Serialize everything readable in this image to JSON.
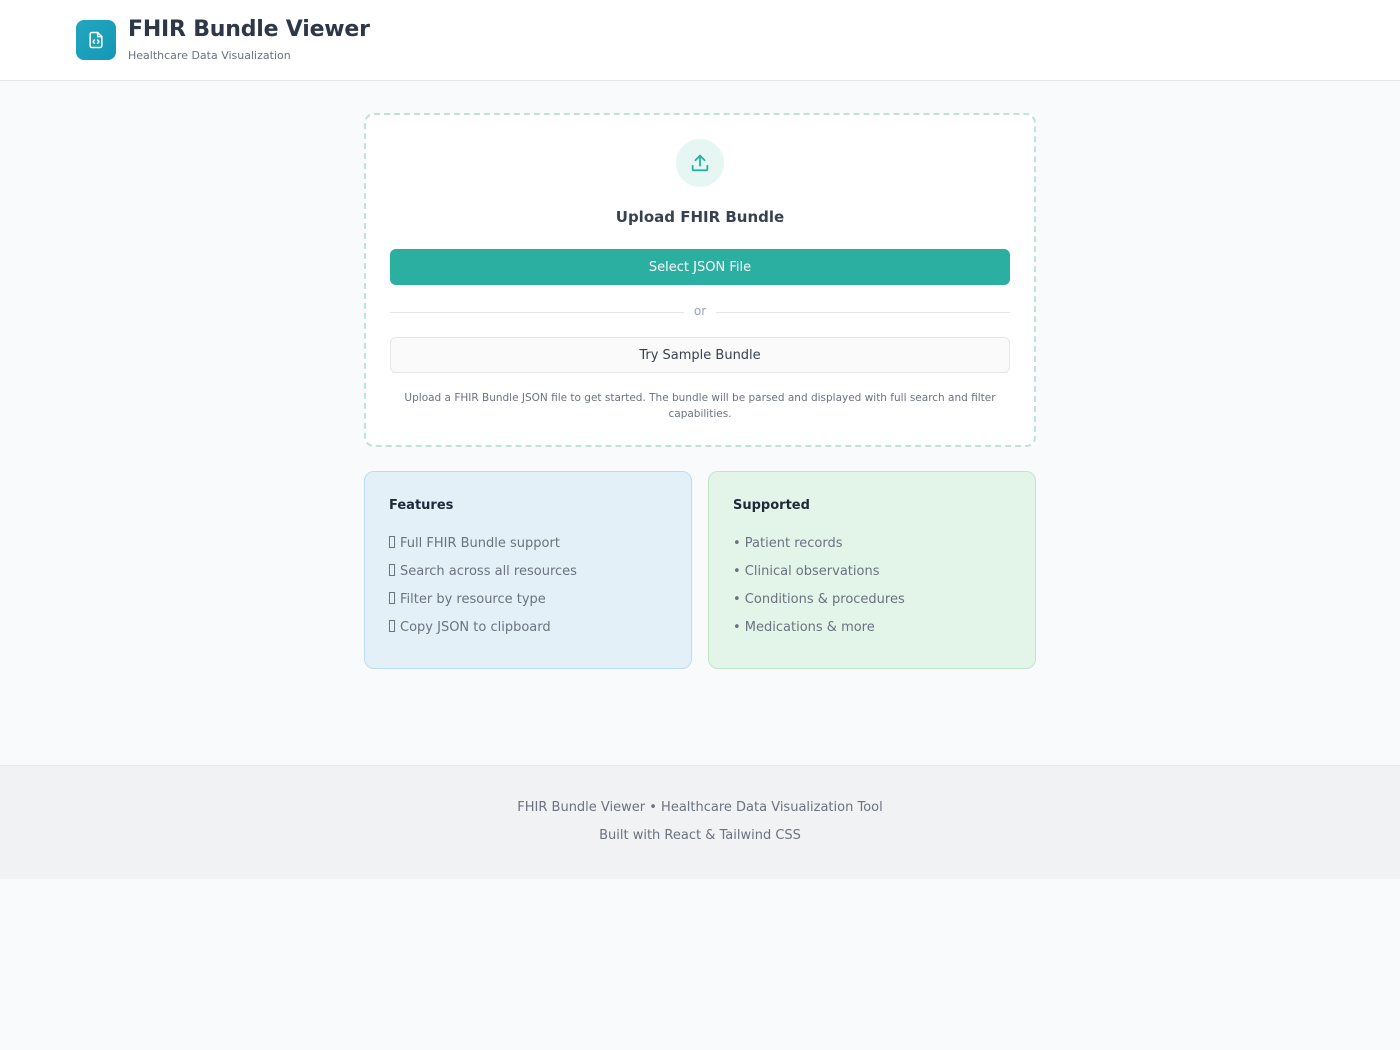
{
  "header": {
    "title": "FHIR Bundle Viewer",
    "subtitle": "Healthcare Data Visualization",
    "logo_icon": "file-code-icon"
  },
  "upload": {
    "icon": "upload-icon",
    "title": "Upload FHIR Bundle",
    "select_button": "Select JSON File",
    "divider": "or",
    "sample_button": "Try Sample Bundle",
    "help_text": "Upload a FHIR Bundle JSON file to get started. The bundle will be parsed and displayed with full search and filter capabilities."
  },
  "features": {
    "title": "Features",
    "items": [
      "Full FHIR Bundle support",
      "Search across all resources",
      "Filter by resource type",
      "Copy JSON to clipboard"
    ]
  },
  "supported": {
    "title": "Supported",
    "items": [
      "• Patient records",
      "• Clinical observations",
      "• Conditions & procedures",
      "• Medications & more"
    ]
  },
  "footer": {
    "line1": "FHIR Bundle Viewer • Healthcare Data Visualization Tool",
    "line2": "Built with React & Tailwind CSS"
  },
  "colors": {
    "accent": "#2bafa0",
    "logo": "#1ea3be",
    "features_bg": "#e3f0f8",
    "supported_bg": "#e3f4e9"
  }
}
